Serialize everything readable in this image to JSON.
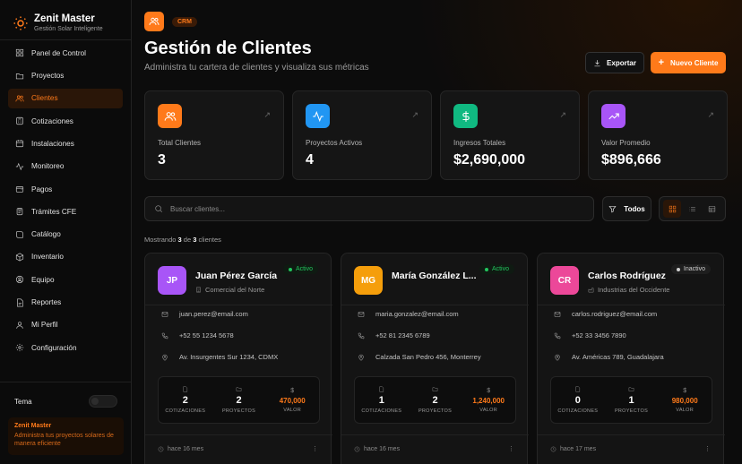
{
  "brand": {
    "title": "Zenit Master",
    "subtitle": "Gestión Solar Inteligente"
  },
  "sidebar": {
    "items": [
      {
        "label": "Panel de Control",
        "icon": "grid-icon"
      },
      {
        "label": "Proyectos",
        "icon": "folder-icon"
      },
      {
        "label": "Clientes",
        "icon": "users-icon",
        "active": true
      },
      {
        "label": "Cotizaciones",
        "icon": "calculator-icon"
      },
      {
        "label": "Instalaciones",
        "icon": "calendar-icon"
      },
      {
        "label": "Monitoreo",
        "icon": "activity-icon"
      },
      {
        "label": "Pagos",
        "icon": "wallet-icon"
      },
      {
        "label": "Trámites CFE",
        "icon": "clipboard-icon"
      },
      {
        "label": "Catálogo",
        "icon": "book-icon"
      },
      {
        "label": "Inventario",
        "icon": "box-icon"
      },
      {
        "label": "Equipo",
        "icon": "team-icon"
      },
      {
        "label": "Reportes",
        "icon": "file-icon"
      },
      {
        "label": "Mi Perfil",
        "icon": "user-icon"
      },
      {
        "label": "Configuración",
        "icon": "gear-icon"
      }
    ],
    "theme_label": "Tema",
    "promo_title": "Zenit Master",
    "promo_text": "Administra tus proyectos solares de manera eficiente"
  },
  "header": {
    "badge": "CRM",
    "title": "Gestión de Clientes",
    "subtitle": "Administra tu cartera de clientes y visualiza sus métricas",
    "export_label": "Exportar",
    "new_label": "Nuevo Cliente"
  },
  "colors": {
    "accent": "#ff7a1a"
  },
  "stats": [
    {
      "label": "Total Clientes",
      "value": "3",
      "color": "#ff7a1a"
    },
    {
      "label": "Proyectos Activos",
      "value": "4",
      "color": "#2196f3"
    },
    {
      "label": "Ingresos Totales",
      "value": "$2,690,000",
      "color": "#10b981"
    },
    {
      "label": "Valor Promedio",
      "value": "$896,666",
      "color": "#a855f7"
    }
  ],
  "search": {
    "placeholder": "Buscar clientes..."
  },
  "filter": {
    "label": "Todos"
  },
  "showing": {
    "prefix": "Mostrando",
    "count": "3",
    "middle": "de",
    "total": "3",
    "suffix": "clientes"
  },
  "clients": [
    {
      "initials": "JP",
      "name": "Juan Pérez García",
      "company": "Comercial del Norte",
      "status": "Activo",
      "avatar_color": "#a855f7",
      "email": "juan.perez@email.com",
      "phone": "+52 55 1234 5678",
      "address": "Av. Insurgentes Sur 1234, CDMX",
      "quotes": "2",
      "projects": "2",
      "value": "470,000",
      "when": "hace 16 mes"
    },
    {
      "initials": "MG",
      "name": "María González L...",
      "company": "",
      "status": "Activo",
      "avatar_color": "#f59e0b",
      "email": "maria.gonzalez@email.com",
      "phone": "+52 81 2345 6789",
      "address": "Calzada San Pedro 456, Monterrey",
      "quotes": "1",
      "projects": "2",
      "value": "1,240,000",
      "when": "hace 16 mes"
    },
    {
      "initials": "CR",
      "name": "Carlos Rodríguez",
      "company": "Industrias del Occidente",
      "status": "Inactivo",
      "avatar_color": "#ec4899",
      "email": "carlos.rodriguez@email.com",
      "phone": "+52 33 3456 7890",
      "address": "Av. Américas 789, Guadalajara",
      "quotes": "0",
      "projects": "1",
      "value": "980,000",
      "when": "hace 17 mes"
    }
  ],
  "metric_labels": {
    "quotes": "COTIZACIONES",
    "projects": "PROYECTOS",
    "value": "VALOR",
    "currency": "$"
  }
}
